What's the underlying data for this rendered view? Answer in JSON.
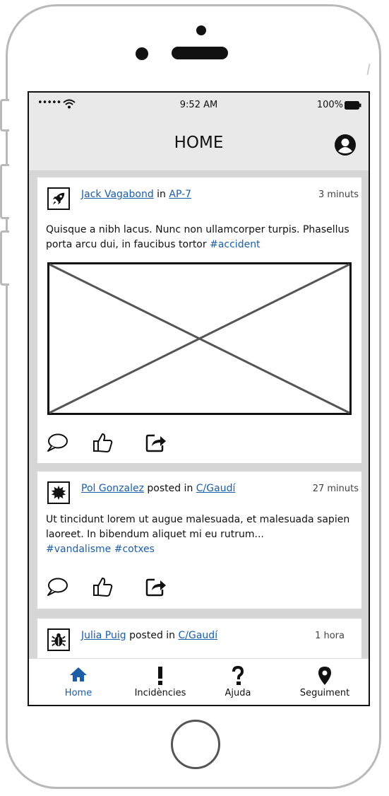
{
  "status_bar": {
    "signal": "•••••",
    "time": "9:52 AM",
    "battery": "100%"
  },
  "header": {
    "title": "HOME",
    "profile_icon": "user-circle-icon"
  },
  "posts": [
    {
      "avatar_icon": "rocket-icon",
      "author": "Jack Vagabond",
      "connector": "in",
      "location": "AP-7",
      "time": "3 minuts",
      "text": "Quisque a nibh lacus. Nunc non ullamcorper turpis. Phasellus porta arcu dui, in faucibus tortor",
      "tags": "#accident",
      "has_image": true
    },
    {
      "avatar_icon": "burst-icon",
      "author": "Pol Gonzalez",
      "connector": "posted in",
      "location": "C/Gaudí",
      "time": "27 minuts",
      "text": "Ut tincidunt lorem ut augue malesuada, et malesuada sapien laoreet. In bibendum aliquet mi eu rutrum...",
      "tags": "#vandalisme #cotxes",
      "has_image": false
    },
    {
      "avatar_icon": "bug-icon",
      "author": "Julia Puig",
      "connector": "posted in",
      "location": "C/Gaudí",
      "time": "1 hora"
    }
  ],
  "post_actions": {
    "comment_icon": "comment-icon",
    "like_icon": "thumbs-up-icon",
    "share_icon": "share-icon"
  },
  "tabs": [
    {
      "label": "Home",
      "icon": "home-icon",
      "active": true
    },
    {
      "label": "Incidències",
      "icon": "exclamation-icon",
      "active": false
    },
    {
      "label": "Ajuda",
      "icon": "question-icon",
      "active": false
    },
    {
      "label": "Seguiment",
      "icon": "map-pin-icon",
      "active": false
    }
  ],
  "colors": {
    "link": "#1b5ea6",
    "active_tab": "#1b5ea6",
    "chrome": "#e9e9e9",
    "feed_bg": "#d6d6d6"
  }
}
